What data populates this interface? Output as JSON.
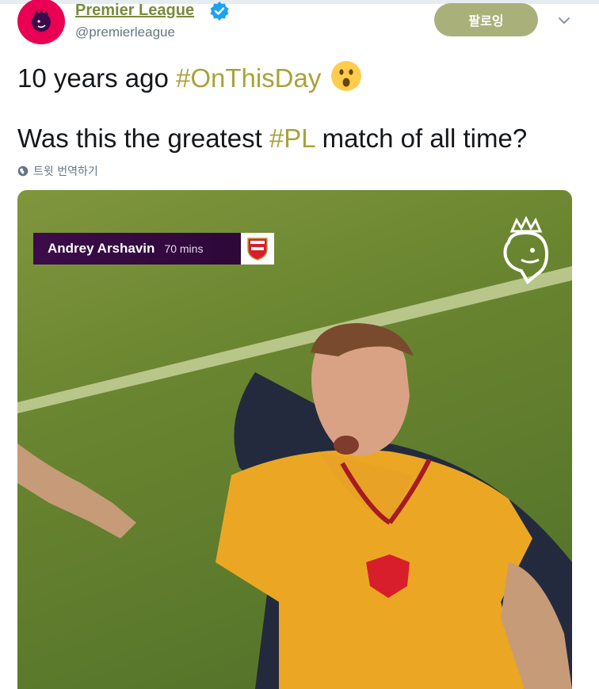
{
  "author": {
    "display_name": "Premier League",
    "handle": "@premierleague",
    "verified": true,
    "avatar_icon": "premier-league-lion-icon",
    "avatar_color": "#e90052"
  },
  "follow_button": {
    "label": "팔로잉",
    "color": "#a9b07a"
  },
  "menu_icon": "chevron-down-icon",
  "tweet": {
    "line1_prefix": "10 years ago ",
    "line1_hashtag": "#OnThisDay",
    "line1_emoji": "astonished-face-emoji",
    "line2_prefix": "Was this the greatest ",
    "line2_hashtag": "#PL",
    "line2_suffix": " match of all time?",
    "hashtag_color": "#a9a23a"
  },
  "translate": {
    "label": "트윗 번역하기",
    "icon": "globe-icon"
  },
  "media": {
    "overlay_player": "Andrey Arshavin",
    "overlay_minute": "70 mins",
    "crest_icon": "arsenal-crest-icon",
    "watermark_icon": "premier-league-lion-icon",
    "banner_color": "#3d0b4a"
  }
}
